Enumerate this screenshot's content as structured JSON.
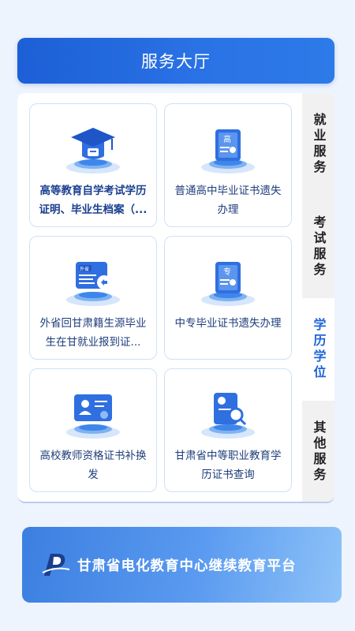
{
  "header": {
    "title": "服务大厅"
  },
  "cards": [
    {
      "label": "高等教育自学考试学历证明、毕业生档案（...",
      "icon": "graduation-cap-icon"
    },
    {
      "label": "普通高中毕业证书遗失办理",
      "icon": "certificate-gao-icon"
    },
    {
      "label": "外省回甘肃籍生源毕业生在甘就业报到证...",
      "icon": "transfer-card-icon"
    },
    {
      "label": "中专毕业证书遗失办理",
      "icon": "certificate-zhuan-icon"
    },
    {
      "label": "高校教师资格证书补换发",
      "icon": "teacher-certificate-icon"
    },
    {
      "label": "甘肃省中等职业教育学历证书查询",
      "icon": "certificate-search-icon"
    }
  ],
  "icon_text": {
    "gao": "高",
    "wai": "外省",
    "zhuan": "专"
  },
  "tabs": [
    {
      "label": "就业服务",
      "active": false
    },
    {
      "label": "考试服务",
      "active": false
    },
    {
      "label": "学历学位",
      "active": true
    },
    {
      "label": "其他服务",
      "active": false
    }
  ],
  "banner": {
    "text": "甘肃省电化教育中心继续教育平台",
    "logo": "platform-logo-icon"
  },
  "colors": {
    "primary": "#1d5fd6",
    "accent": "#2066d8",
    "card_border": "#cfe0f7"
  }
}
